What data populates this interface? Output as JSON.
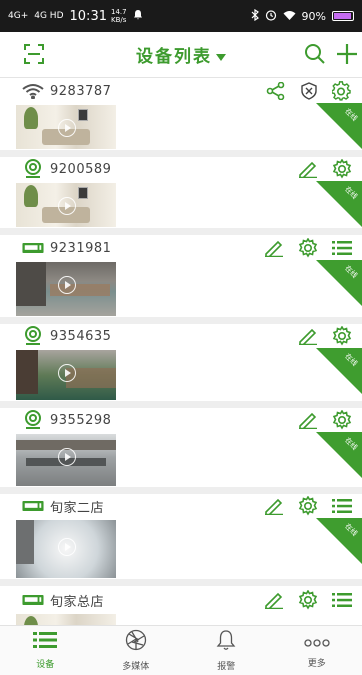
{
  "status_bar": {
    "signal_1": "4G+",
    "signal_2": "4G HD",
    "time": "10:31",
    "speed": "14.7",
    "speed_unit": "KB/s",
    "battery_percent": "90%"
  },
  "header": {
    "title": "设备列表"
  },
  "devices": [
    {
      "id": "9283787",
      "type": "wifi",
      "actions": [
        "share",
        "shield",
        "settings"
      ],
      "badge": "在线"
    },
    {
      "id": "9200589",
      "type": "camera",
      "actions": [
        "edit",
        "settings"
      ],
      "badge": "在线"
    },
    {
      "id": "9231981",
      "type": "nvr",
      "actions": [
        "edit",
        "settings",
        "menu"
      ],
      "badge": "在线"
    },
    {
      "id": "9354635",
      "type": "camera",
      "actions": [
        "edit",
        "settings"
      ],
      "badge": "在线"
    },
    {
      "id": "9355298",
      "type": "camera",
      "actions": [
        "edit",
        "settings"
      ],
      "badge": "在线"
    },
    {
      "id": "旬家二店",
      "type": "nvr",
      "actions": [
        "edit",
        "settings",
        "menu"
      ],
      "badge": "在线"
    },
    {
      "id": "旬家总店",
      "type": "nvr",
      "actions": [
        "edit",
        "settings",
        "menu"
      ],
      "badge": "在线"
    }
  ],
  "tabs": [
    {
      "label": "设备",
      "icon": "list-icon",
      "active": true
    },
    {
      "label": "多媒体",
      "icon": "aperture-icon",
      "active": false
    },
    {
      "label": "报警",
      "icon": "bell-icon",
      "active": false
    },
    {
      "label": "更多",
      "icon": "more-icon",
      "active": false
    }
  ],
  "colors": {
    "accent": "#3d9b2e",
    "status_bar": "#1a1a1a",
    "divider": "#eeeeee"
  }
}
